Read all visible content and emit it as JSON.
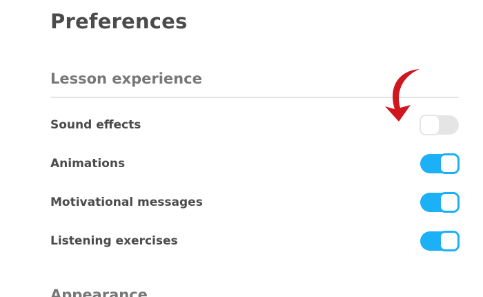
{
  "page": {
    "title": "Preferences"
  },
  "sections": [
    {
      "heading": "Lesson experience",
      "settings": [
        {
          "label": "Sound effects",
          "enabled": false
        },
        {
          "label": "Animations",
          "enabled": true
        },
        {
          "label": "Motivational messages",
          "enabled": true
        },
        {
          "label": "Listening exercises",
          "enabled": true
        }
      ]
    },
    {
      "heading": "Appearance"
    }
  ],
  "annotation": {
    "icon": "curved-arrow-icon",
    "color": "#d0161f"
  },
  "colors": {
    "toggle_on": "#1cb0f6",
    "toggle_off": "#e5e5e5",
    "title_text": "#4b4b4b",
    "section_text": "#777777"
  }
}
